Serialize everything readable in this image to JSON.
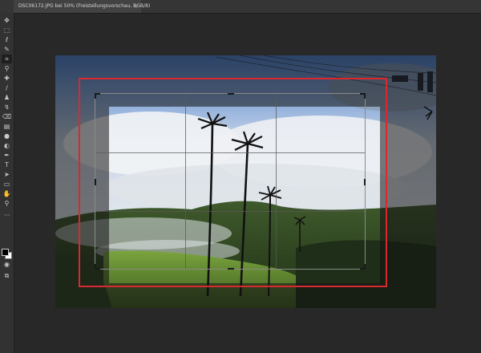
{
  "document": {
    "tab_title": "DSC06172.JPG bei 50% (Freistellungsvorschau, RGB/8)",
    "close_glyph": "×"
  },
  "toolbar": {
    "tools": [
      {
        "name": "move-tool-icon",
        "glyph": "✥"
      },
      {
        "name": "rectangular-marquee-tool-icon",
        "glyph": "⬚"
      },
      {
        "name": "lasso-tool-icon",
        "glyph": "ℓ"
      },
      {
        "name": "quick-selection-tool-icon",
        "glyph": "✎"
      },
      {
        "name": "crop-tool-icon",
        "glyph": "⌗",
        "active": true
      },
      {
        "name": "eyedropper-tool-icon",
        "glyph": "⚲"
      },
      {
        "name": "spot-healing-brush-icon",
        "glyph": "✚"
      },
      {
        "name": "brush-tool-icon",
        "glyph": "∕"
      },
      {
        "name": "clone-stamp-tool-icon",
        "glyph": "♟"
      },
      {
        "name": "history-brush-icon",
        "glyph": "↯"
      },
      {
        "name": "eraser-tool-icon",
        "glyph": "⌫"
      },
      {
        "name": "gradient-tool-icon",
        "glyph": "▤"
      },
      {
        "name": "blur-tool-icon",
        "glyph": "●"
      },
      {
        "name": "dodge-tool-icon",
        "glyph": "◐"
      },
      {
        "name": "pen-tool-icon",
        "glyph": "✒"
      },
      {
        "name": "type-tool-icon",
        "glyph": "T"
      },
      {
        "name": "path-selection-tool-icon",
        "glyph": "➤"
      },
      {
        "name": "rectangle-tool-icon",
        "glyph": "▭"
      },
      {
        "name": "hand-tool-icon",
        "glyph": "✋"
      },
      {
        "name": "zoom-tool-icon",
        "glyph": "⚲"
      },
      {
        "name": "edit-toolbar-icon",
        "glyph": "···"
      }
    ],
    "extra": [
      {
        "name": "quick-mask-icon",
        "glyph": "◉"
      },
      {
        "name": "screen-mode-icon",
        "glyph": "⧉"
      }
    ]
  },
  "colors": {
    "foreground": "#000000",
    "background": "#ffffff",
    "highlight": "#d9282f"
  }
}
